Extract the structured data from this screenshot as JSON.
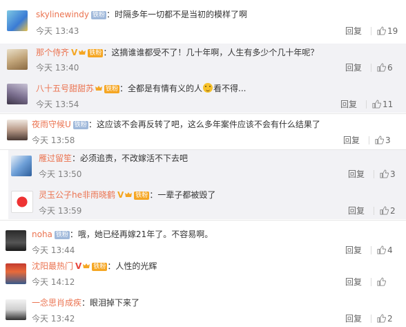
{
  "comments": [
    {
      "username": "skylinewindy",
      "badge": "铁粉",
      "text": "：时隔多年一切都不是当初的模样了啊",
      "time": "今天 13:43",
      "reply": "回复",
      "likes": "19"
    },
    {
      "username": "那个侍齐",
      "badge": "铁粉",
      "text": "：这摘谁谁都受不了！几十年啊，人生有多少个几十年呢？",
      "time": "今天 13:40",
      "reply": "回复",
      "likes": "6"
    },
    {
      "username": "八十五号甜甜苏",
      "badge": "铁粉",
      "text_before": "：全都是有情有义的人",
      "text_after": "看不得...",
      "time": "今天 13:54",
      "reply": "回复",
      "likes": "11"
    },
    {
      "username": "夜雨守候U",
      "badge": "铁粉",
      "text": "：这应该不会再反转了吧，这么多年案件应该不会有什么结果了",
      "time": "今天 13:58",
      "reply": "回复",
      "likes": "3"
    },
    {
      "username": "雁过留笙",
      "text": "：必须追责，不改嫁活不下去吧",
      "time": "今天 13:50",
      "reply": "回复",
      "likes": "3"
    },
    {
      "username": "灵玉公子he非雨晓鹤",
      "badge": "铁粉",
      "text": "：一辈子都被毁了",
      "time": "今天 13:59",
      "reply": "回复",
      "likes": "2"
    },
    {
      "username": "noha",
      "badge": "铁粉",
      "text": "：哦，她已经再嫁21年了。不容易啊。",
      "time": "今天 13:44",
      "reply": "回复",
      "likes": "4"
    },
    {
      "username": "沈阳最热门",
      "badge": "铁粉",
      "text": "：人性的光辉",
      "time": "今天 14:12",
      "reply": "回复",
      "likes": ""
    },
    {
      "username": "一念思肖成疾",
      "text": "：眼泪掉下来了",
      "time": "今天 13:42",
      "reply": "回复",
      "likes": "2"
    }
  ],
  "colors": {
    "username": "#eb7350",
    "badge_fan": "#9fb8da",
    "vip": "#f5a623"
  }
}
